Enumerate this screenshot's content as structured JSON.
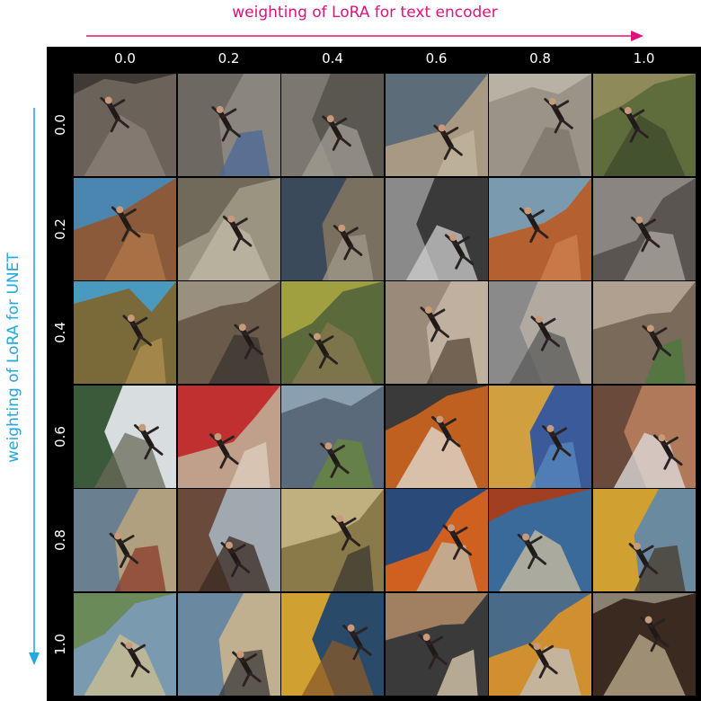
{
  "x_axis": {
    "title": "weighting of LoRA for text encoder",
    "color": "#e0137e",
    "values": [
      "0.0",
      "0.2",
      "0.4",
      "0.6",
      "0.8",
      "1.0"
    ]
  },
  "y_axis": {
    "title": "weighting of LoRA for UNET",
    "color": "#22a7e0",
    "values": [
      "0.0",
      "0.2",
      "0.4",
      "0.6",
      "0.8",
      "1.0"
    ]
  },
  "grid": {
    "rows": 6,
    "cols": 6,
    "palettes": [
      [
        [
          "#6b625a",
          "#3f3a35",
          "#8b8278"
        ],
        [
          "#6e6862",
          "#8a857d",
          "#4a6a9a"
        ],
        [
          "#7c7770",
          "#5a5650",
          "#a39d93"
        ],
        [
          "#a89a82",
          "#5d6c79",
          "#c4b79f"
        ],
        [
          "#9a9488",
          "#b8b2a5",
          "#7b7468"
        ],
        [
          "#5f6d3c",
          "#8f8a5a",
          "#3c4a2b"
        ]
      ],
      [
        [
          "#8a5a3a",
          "#4a86b0",
          "#b07a4a"
        ],
        [
          "#9a9480",
          "#6f6a5a",
          "#c0bba8"
        ],
        [
          "#3a4a5a",
          "#7a7060",
          "#a0988a"
        ],
        [
          "#8a8a8a",
          "#3a3a3a",
          "#cfcfcf"
        ],
        [
          "#b46030",
          "#7a9ab0",
          "#d08050"
        ],
        [
          "#5a5550",
          "#8a8580",
          "#b0aaa3"
        ]
      ],
      [
        [
          "#7a6a3a",
          "#4a9ac0",
          "#b09050"
        ],
        [
          "#6a5a4a",
          "#9a9080",
          "#3a3530"
        ],
        [
          "#5a6a3a",
          "#a0a040",
          "#8a7a50"
        ],
        [
          "#9a8a7a",
          "#c0b0a0",
          "#5a4a3a"
        ],
        [
          "#8a8a8a",
          "#b0aaa0",
          "#5a5a5a"
        ],
        [
          "#7a6a5a",
          "#b0a090",
          "#4a7a3a"
        ]
      ],
      [
        [
          "#3a5a3a",
          "#d8dde0",
          "#6a6a5a"
        ],
        [
          "#c0a08a",
          "#c03030",
          "#e0d0c0"
        ],
        [
          "#5a6a7a",
          "#8aa0b0",
          "#6a8a3a"
        ],
        [
          "#c06020",
          "#3a3a3a",
          "#e0e0d8"
        ],
        [
          "#d0a040",
          "#3a5a9a",
          "#5a8ac0"
        ],
        [
          "#6a4a3a",
          "#b07a5a",
          "#e0e0e0"
        ]
      ],
      [
        [
          "#6a8090",
          "#b0a080",
          "#8a3a2a"
        ],
        [
          "#6a4a3a",
          "#a0a8b0",
          "#3a2a20"
        ],
        [
          "#8a7a4a",
          "#c0b080",
          "#3a3a30"
        ],
        [
          "#d06020",
          "#2a4a7a",
          "#c0c0b0"
        ],
        [
          "#3a6a9a",
          "#a04020",
          "#d0c0a0"
        ],
        [
          "#d0a030",
          "#6a8aa0",
          "#4a3a2a"
        ]
      ],
      [
        [
          "#7a9ab0",
          "#6a8a5a",
          "#d0c090"
        ],
        [
          "#6a88a0",
          "#c0b090",
          "#3a3a3a"
        ],
        [
          "#d0a030",
          "#2a4a6a",
          "#8a5a2a"
        ],
        [
          "#3a3a3a",
          "#a08060",
          "#e0d0b0"
        ],
        [
          "#d09030",
          "#4a6a8a",
          "#c0c0c0"
        ],
        [
          "#3a2a20",
          "#8a8070",
          "#c0b090"
        ]
      ]
    ]
  }
}
